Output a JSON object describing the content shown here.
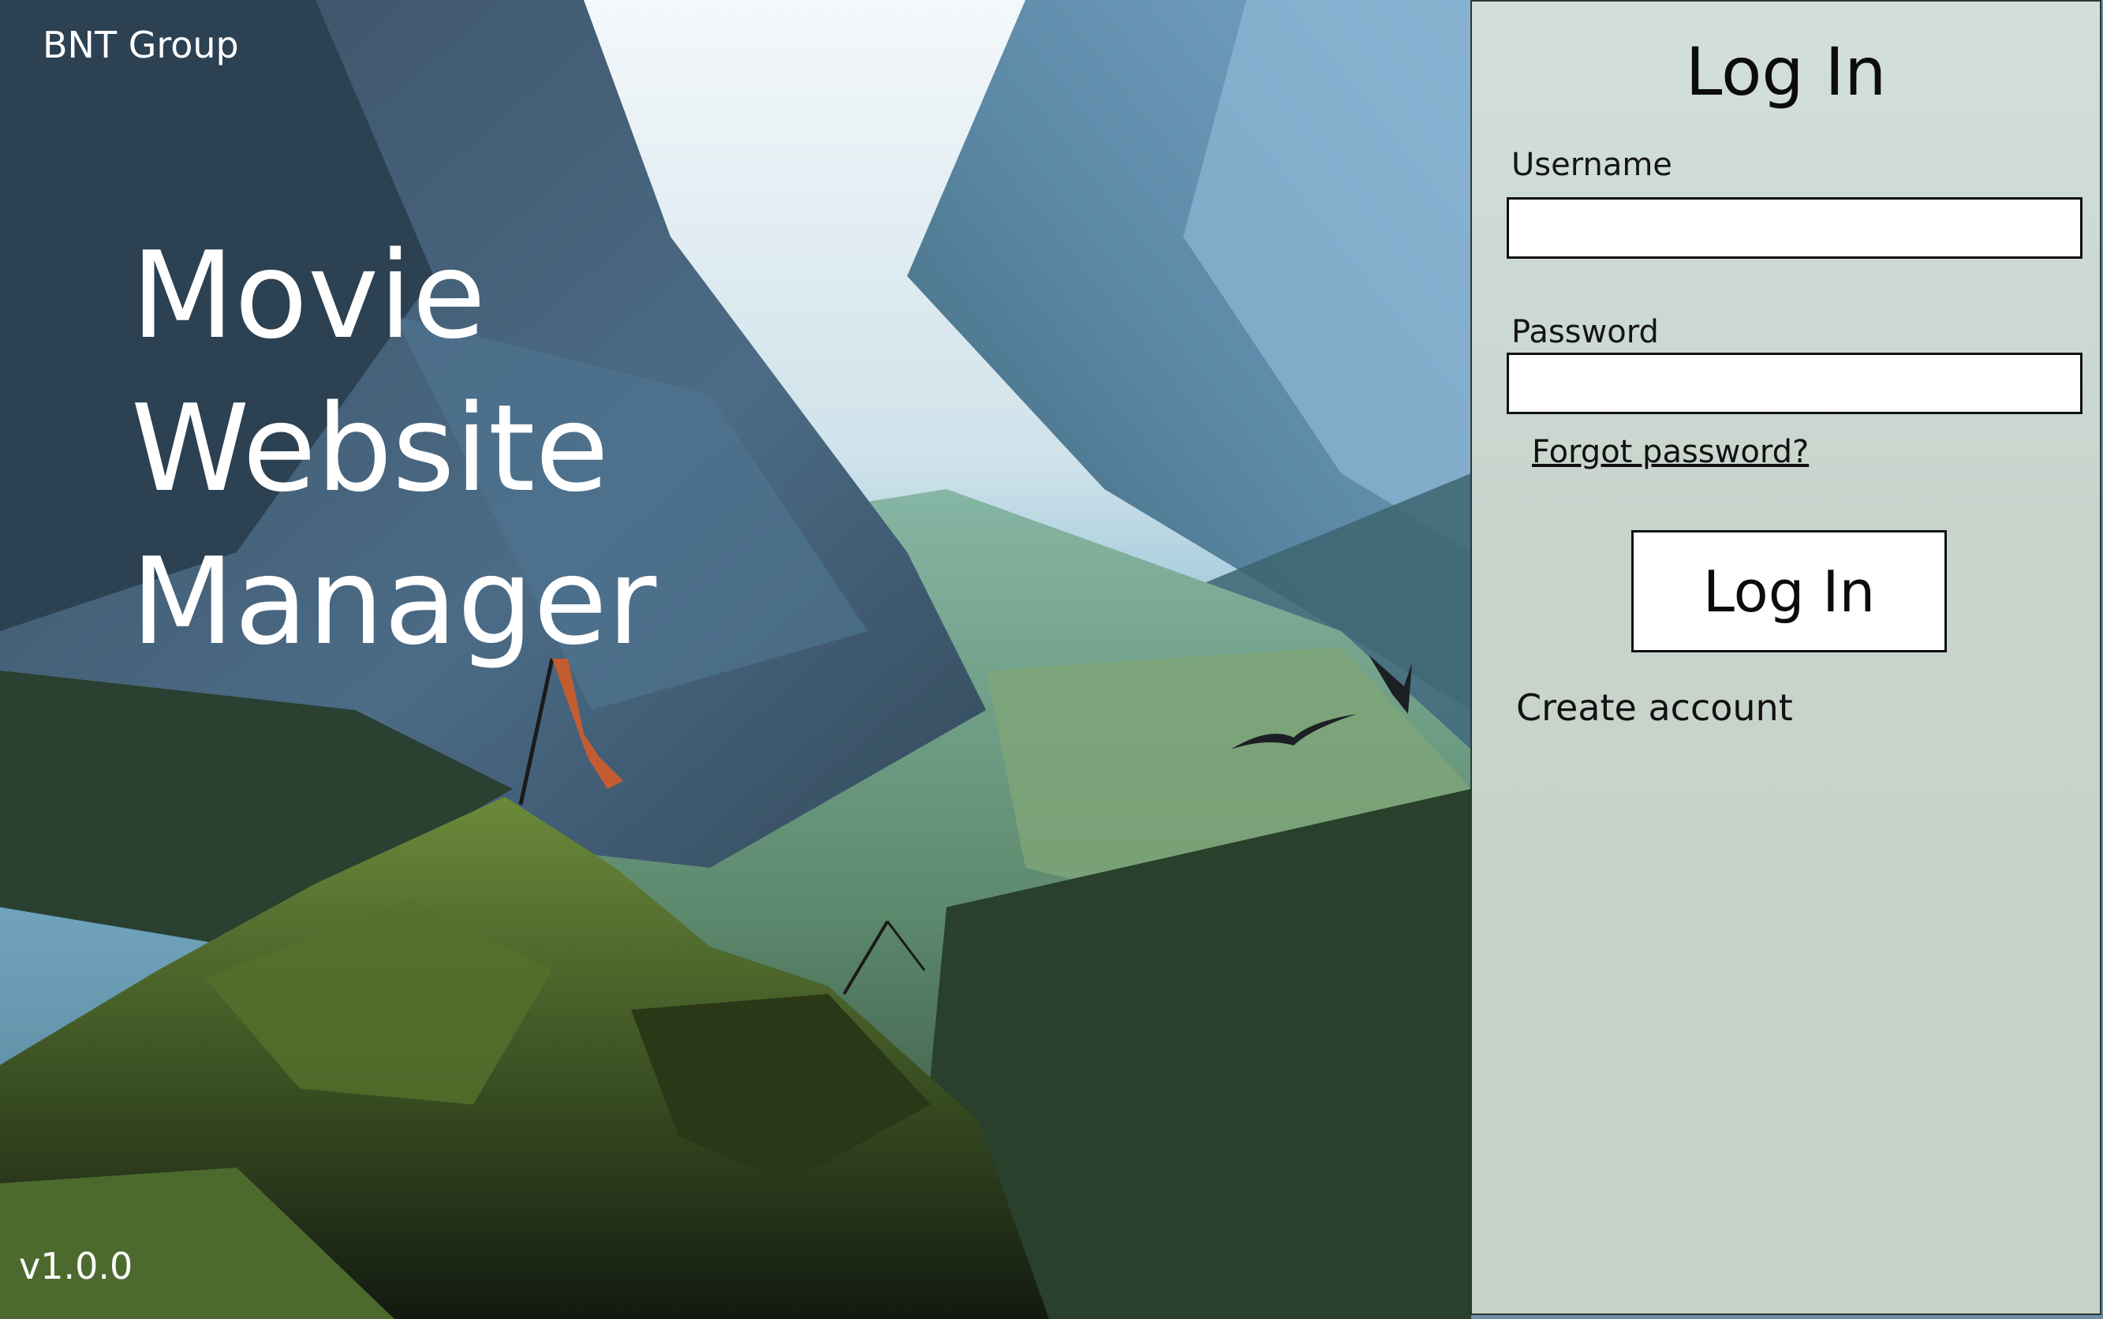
{
  "brand": {
    "company": "BNT Group",
    "version": "v1.0.0"
  },
  "hero": {
    "title_lines": [
      "Movie",
      "Website",
      "Manager"
    ]
  },
  "login": {
    "title": "Log In",
    "username_label": "Username",
    "username_value": "",
    "password_label": "Password",
    "password_value": "",
    "forgot_link": "Forgot password?",
    "submit_label": "Log In",
    "create_account": "Create account"
  },
  "colors": {
    "panel_bg": "#cbd7d0",
    "text": "#111111",
    "hero_text": "#ffffff"
  }
}
